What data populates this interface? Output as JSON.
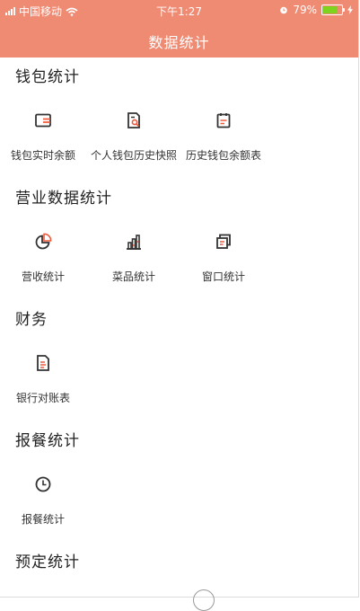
{
  "status_bar": {
    "carrier": "中国移动",
    "time": "下午1:27",
    "battery": "79%",
    "battery_level": 0.79
  },
  "header": {
    "title": "数据统计"
  },
  "sections": [
    {
      "title": "钱包统计",
      "items": [
        {
          "icon": "wallet-icon",
          "label": "钱包实时余额"
        },
        {
          "icon": "document-search-icon",
          "label": "个人钱包历史快照"
        },
        {
          "icon": "clipboard-icon",
          "label": "历史钱包余额表"
        }
      ]
    },
    {
      "title": "营业数据统计",
      "items": [
        {
          "icon": "pie-chart-icon",
          "label": "营收统计"
        },
        {
          "icon": "bar-chart-icon",
          "label": "菜品统计"
        },
        {
          "icon": "windows-stack-icon",
          "label": "窗口统计"
        }
      ]
    },
    {
      "title": "财务",
      "items": [
        {
          "icon": "document-icon",
          "label": "银行对账表"
        }
      ]
    },
    {
      "title": "报餐统计",
      "items": [
        {
          "icon": "clock-icon",
          "label": "报餐统计"
        }
      ]
    },
    {
      "title": "预定统计",
      "items": []
    }
  ],
  "colors": {
    "header_bg": "#ef8a73",
    "icon_dark": "#333333",
    "icon_accent": "#ef5a3c"
  }
}
